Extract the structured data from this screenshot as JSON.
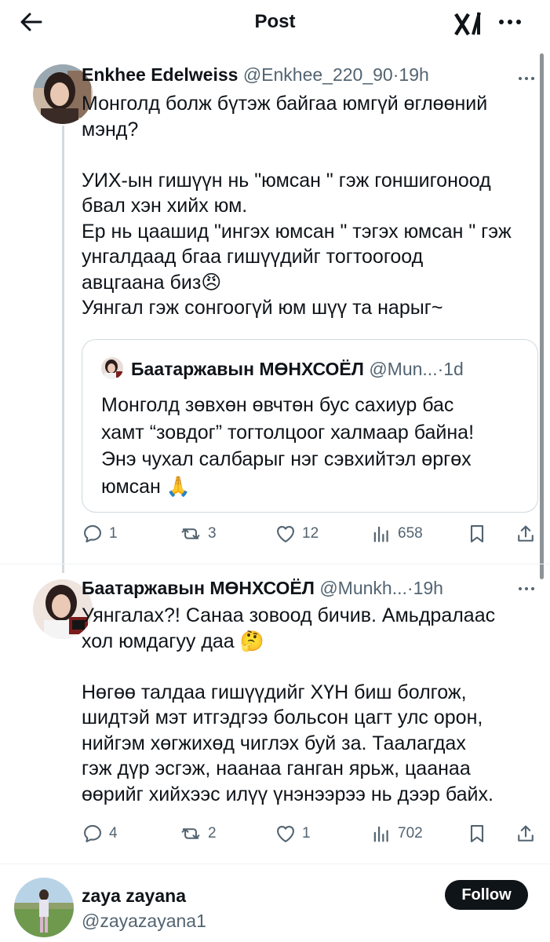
{
  "header": {
    "title": "Post",
    "back_icon": "arrow-left-icon",
    "logo_icon": "xai-logo-icon",
    "more_icon": "more-horizontal-icon"
  },
  "tweets": [
    {
      "name": "Enkhee Edelweiss",
      "handle": "@Enkhee_220_90",
      "dot": "·",
      "time": "19h",
      "lines": [
        "Монголд болж бүтэж байгаа юмгүй өглөөний",
        "мэнд?",
        "",
        "УИХ-ын гишүүн нь \"юмсан \" гэж гоншигоноод",
        "бвал хэн хийх юм.",
        "Ер нь цаашид \"ингэх юмсан \" тэгэх юмсан \" гэж",
        "унгалдаад бгаа гишүүдийг тогтоогоод",
        "авцгаана биз😠",
        "Уянгал гэж сонгоогүй юм шүү та нарыг~"
      ],
      "quote": {
        "name": "Баатаржавын МӨНХСОЁЛ",
        "handle": "@Mun...",
        "dot": "·",
        "time": "1d",
        "lines": [
          "Монголд зөвхөн өвчтөн бус сахиур бас",
          "хамт “зовдог” тогтолцоог халмаар байна!",
          "Энэ чухал салбарыг нэг сэвхийтэл өргөх",
          "юмсан 🙏"
        ]
      },
      "stats": {
        "replies": "1",
        "reposts": "3",
        "likes": "12",
        "views": "658"
      }
    },
    {
      "name": "Баатаржавын МӨНХСОЁЛ",
      "handle": "@Munkh...",
      "dot": "·",
      "time": "19h",
      "lines": [
        "Уянгалах?! Санаа зовоод бичив. Амьдралаас",
        "хол юмдагуу даа 🤔",
        "",
        "Нөгөө талдаа гишүүдийг ХҮН биш болгож,",
        "шидтэй мэт итгэдгээ больсон цагт улс орон,",
        "нийгэм хөгжихөд чиглэх буй за. Таалагдах",
        "гэж дүр эсгэж, наанаа ганган ярьж, цаанаа",
        "өөрийг хийхээс илүү үнэнээрээ нь дээр байх."
      ],
      "stats": {
        "replies": "4",
        "reposts": "2",
        "likes": "1",
        "views": "702"
      }
    }
  ],
  "suggestion": {
    "name": "zaya zayana",
    "handle": "@zayazayana1",
    "follow_label": "Follow"
  },
  "colors": {
    "text": "#0f1419",
    "secondary": "#536471",
    "border": "#cfd9de",
    "follow_bg": "#0f1419"
  }
}
